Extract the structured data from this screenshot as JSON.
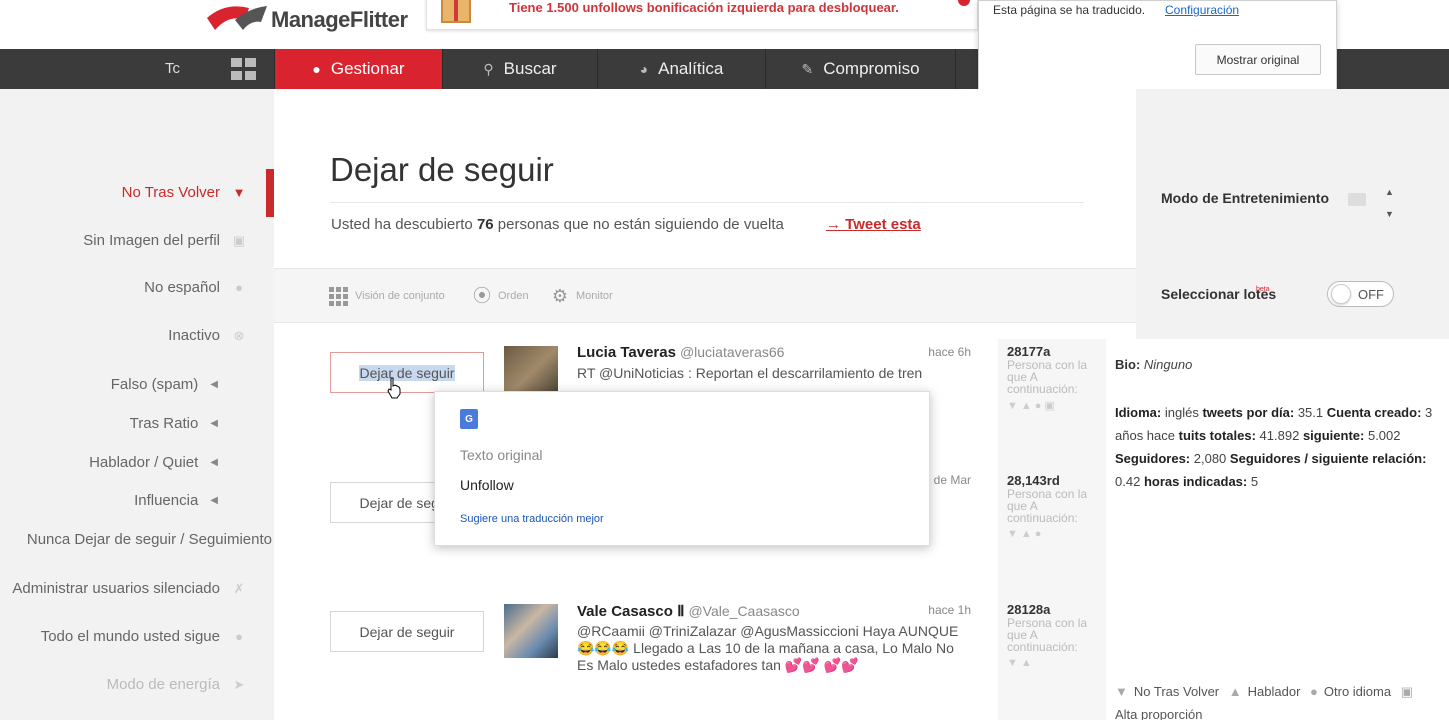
{
  "app": {
    "name": "ManageFlitter"
  },
  "promo": {
    "text": "Tiene 1.500 unfollows bonificación izquierda para desbloquear."
  },
  "nav": {
    "left_text": "Tc",
    "tabs": [
      {
        "label": "Gestionar",
        "icon": "user-icon"
      },
      {
        "label": "Buscar",
        "icon": "search-icon"
      },
      {
        "label": "Analítica",
        "icon": "dashboard-icon"
      },
      {
        "label": "Compromiso",
        "icon": "edit-icon"
      }
    ]
  },
  "translate_bar": {
    "text": "Esta página se ha traducido.",
    "link": "Configuración",
    "button": "Mostrar original"
  },
  "sidebar": {
    "items": [
      {
        "label": "No Tras Volver",
        "icon": "thumbs-down-icon"
      },
      {
        "label": "Sin Imagen del perfil",
        "icon": "image-icon"
      },
      {
        "label": "No español",
        "icon": "speech-bubble-icon"
      },
      {
        "label": "Inactivo",
        "icon": "x-circle-icon"
      },
      {
        "label": "Falso (spam)",
        "icon": "triangle-left-icon"
      },
      {
        "label": "Tras Ratio",
        "icon": "triangle-left-icon"
      },
      {
        "label": "Hablador / Quiet",
        "icon": "triangle-left-icon"
      },
      {
        "label": "Influencia",
        "icon": "triangle-left-icon"
      },
      {
        "label": "Nunca Dejar de seguir / Seguimiento",
        "icon": ""
      },
      {
        "label": "Administrar usuarios silenciado",
        "icon": "mute-icon"
      },
      {
        "label": "Todo el mundo usted sigue",
        "icon": "group-icon"
      },
      {
        "label": "Modo de energía",
        "icon": "rocket-icon"
      }
    ]
  },
  "main": {
    "title": "Dejar de seguir",
    "subtitle_pre": "Usted ha descubierto",
    "subtitle_count": "76",
    "subtitle_post": "personas que no están siguiendo de vuelta",
    "tweet_link": "→ Tweet esta",
    "toolbar": {
      "overview": "Visión de conjunto",
      "order": "Orden",
      "monitor": "Monitor"
    },
    "rows": [
      {
        "button": "Dejar de seguir",
        "name": "Lucia Taveras",
        "handle": "@luciataveras66",
        "ago": "hace 6h",
        "tweet": "RT @UniNoticias : Reportan el descarrilamiento de tren",
        "stat": "28177a",
        "stat_label": "Persona con la que A continuación:"
      },
      {
        "button": "Dejar de seguir",
        "name": "",
        "handle": "",
        "ago": "de Mar",
        "tweet": "",
        "stat": "28,143rd",
        "stat_label": "Persona con la que A continuación:"
      },
      {
        "button": "Dejar de seguir",
        "name": "Vale Casasco Ⅱ",
        "handle": "@Vale_Caasasco",
        "ago": "hace 1h",
        "tweet": "@RCaamii @TriniZalazar @AgusMassiccioni Haya AUNQUE 😂😂😂 Llegado a Las 10 de la mañana a casa, Lo Malo No Es Malo ustedes estafadores tan 💕💕 💕💕",
        "stat": "28128a",
        "stat_label": "Persona con la que A continuación:"
      }
    ]
  },
  "right": {
    "entertainment": "Modo de Entretenimiento",
    "batch": "Seleccionar lotes",
    "beta": "beta",
    "toggle": "OFF"
  },
  "bio": {
    "bio_label": "Bio:",
    "bio_value": "Ninguno",
    "lang_label": "Idioma:",
    "lang_value": "inglés",
    "tpd_label": "tweets por día:",
    "tpd_value": "35.1",
    "created_label": "Cuenta creado:",
    "created_value": "3 años hace",
    "tt_label": "tuits totales:",
    "tt_value": "41.892",
    "following_label": "siguiente:",
    "following_value": "5.002",
    "followers_label": "Seguidores:",
    "followers_value": "2,080",
    "ratio_label": "Seguidores / siguiente relación:",
    "ratio_value": "0.42",
    "hours_label": "horas indicadas:",
    "hours_value": "5"
  },
  "tags": {
    "t1": "No Tras Volver",
    "t2": "Hablador",
    "t3": "Otro idioma",
    "t4": "Alta proporción"
  },
  "translate_popup": {
    "label": "Texto original",
    "value": "Unfollow",
    "link": "Sugiere una traducción mejor"
  }
}
